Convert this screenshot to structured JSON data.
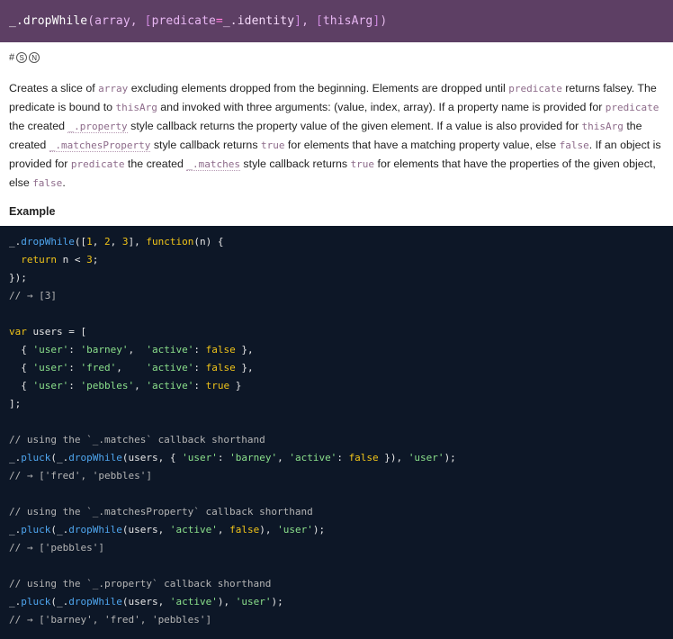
{
  "signature": {
    "prefix": "_.",
    "name": "dropWhile",
    "open": "(",
    "param1": "array",
    "sep1": ", ",
    "p2_open": "[",
    "p2_name": "predicate",
    "p2_eq": "=",
    "p2_default": "_.identity",
    "p2_close": "]",
    "sep2": ", ",
    "p3_open": "[",
    "p3_name": "thisArg",
    "p3_close": "]",
    "close": ")"
  },
  "links": {
    "hash": "#",
    "source": "S",
    "npm": "N"
  },
  "description": {
    "t1": "Creates a slice of ",
    "c1": "array",
    "t2": " excluding elements dropped from the beginning. Elements are dropped until ",
    "c2": "predicate",
    "t3": " returns falsey. The predicate is bound to ",
    "c3": "thisArg",
    "t4": " and invoked with three arguments: (value, index, array). If a property name is provided for ",
    "c4": "predicate",
    "t5": " the created ",
    "l1": "_.property",
    "t6": " style callback returns the property value of the given element. If a value is also provided for ",
    "c5": "thisArg",
    "t7": " the created ",
    "l2": "_.matchesProperty",
    "t8": " style callback returns ",
    "c6": "true",
    "t9": " for elements that have a matching property value, else ",
    "c7": "false",
    "t10": ". If an object is provided for ",
    "c8": "predicate",
    "t11": " the created ",
    "l3": "_.matches",
    "t12": " style callback returns ",
    "c9": "true",
    "t13": " for elements that have the properties of the given object, else ",
    "c10": "false",
    "t14": "."
  },
  "example_title": "Example",
  "code": {
    "l1_a": "_.",
    "l1_fn": "dropWhile",
    "l1_b": "([",
    "l1_n1": "1",
    "l1_c1": ", ",
    "l1_n2": "2",
    "l1_c2": ", ",
    "l1_n3": "3",
    "l1_d": "], ",
    "l1_kw": "function",
    "l1_e": "(n) {",
    "l2_a": "  ",
    "l2_kw": "return",
    "l2_b": " n < ",
    "l2_n": "3",
    "l2_c": ";",
    "l3": "});",
    "l4": "// → [3]",
    "l6_kw": "var",
    "l6_b": " users = [",
    "l7_a": "  { ",
    "l7_s1": "'user'",
    "l7_b": ": ",
    "l7_s2": "'barney'",
    "l7_c": ",  ",
    "l7_s3": "'active'",
    "l7_d": ": ",
    "l7_bool": "false",
    "l7_e": " },",
    "l8_a": "  { ",
    "l8_s1": "'user'",
    "l8_b": ": ",
    "l8_s2": "'fred'",
    "l8_c": ",    ",
    "l8_s3": "'active'",
    "l8_d": ": ",
    "l8_bool": "false",
    "l8_e": " },",
    "l9_a": "  { ",
    "l9_s1": "'user'",
    "l9_b": ": ",
    "l9_s2": "'pebbles'",
    "l9_c": ", ",
    "l9_s3": "'active'",
    "l9_d": ": ",
    "l9_bool": "true",
    "l9_e": " }",
    "l10": "];",
    "l12": "// using the `_.matches` callback shorthand",
    "l13_a": "_.",
    "l13_fn": "pluck",
    "l13_b": "(_.",
    "l13_fn2": "dropWhile",
    "l13_c": "(users, { ",
    "l13_s1": "'user'",
    "l13_d": ": ",
    "l13_s2": "'barney'",
    "l13_e": ", ",
    "l13_s3": "'active'",
    "l13_f": ": ",
    "l13_bool": "false",
    "l13_g": " }), ",
    "l13_s4": "'user'",
    "l13_h": ");",
    "l14": "// → ['fred', 'pebbles']",
    "l16": "// using the `_.matchesProperty` callback shorthand",
    "l17_a": "_.",
    "l17_fn": "pluck",
    "l17_b": "(_.",
    "l17_fn2": "dropWhile",
    "l17_c": "(users, ",
    "l17_s1": "'active'",
    "l17_d": ", ",
    "l17_bool": "false",
    "l17_e": "), ",
    "l17_s2": "'user'",
    "l17_f": ");",
    "l18": "// → ['pebbles']",
    "l20": "// using the `_.property` callback shorthand",
    "l21_a": "_.",
    "l21_fn": "pluck",
    "l21_b": "(_.",
    "l21_fn2": "dropWhile",
    "l21_c": "(users, ",
    "l21_s1": "'active'",
    "l21_d": "), ",
    "l21_s2": "'user'",
    "l21_e": ");",
    "l22": "// → ['barney', 'fred', 'pebbles']"
  }
}
